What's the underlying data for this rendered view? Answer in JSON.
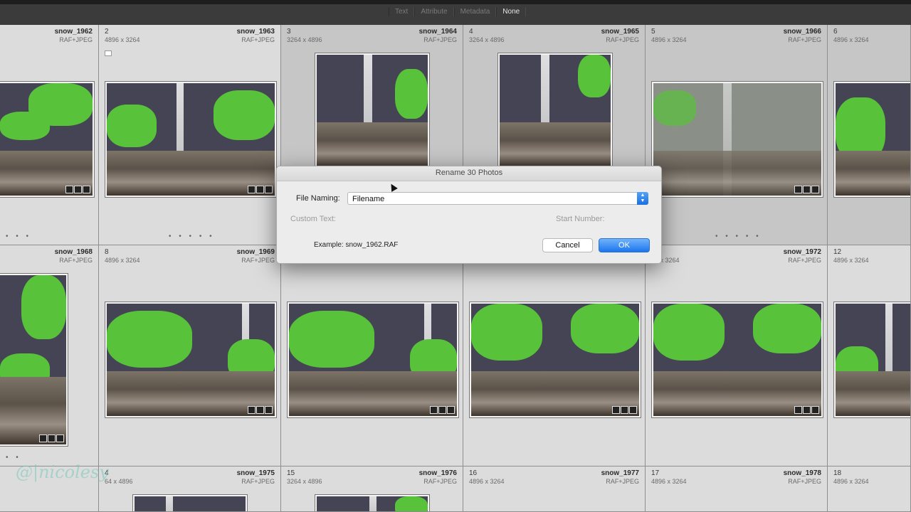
{
  "filter_bar": {
    "tabs": [
      "Text",
      "Attribute",
      "Metadata",
      "None"
    ],
    "active": "None"
  },
  "grid": {
    "row1": [
      {
        "index": "",
        "filename": "snow_1962",
        "type": "RAF+JPEG",
        "dims": ""
      },
      {
        "index": "2",
        "filename": "snow_1963",
        "type": "RAF+JPEG",
        "dims": "4896 x 3264"
      },
      {
        "index": "3",
        "filename": "snow_1964",
        "type": "RAF+JPEG",
        "dims": "3264 x 4896"
      },
      {
        "index": "4",
        "filename": "snow_1965",
        "type": "RAF+JPEG",
        "dims": "3264 x 4896"
      },
      {
        "index": "5",
        "filename": "snow_1966",
        "type": "RAF+JPEG",
        "dims": "4896 x 3264"
      },
      {
        "index": "6",
        "filename": "",
        "type": "",
        "dims": "4896 x 3264"
      }
    ],
    "row2": [
      {
        "index": "",
        "filename": "snow_1968",
        "type": "RAF+JPEG",
        "dims": ""
      },
      {
        "index": "8",
        "filename": "snow_1969",
        "type": "RAF+JPEG",
        "dims": "4896 x 3264"
      },
      {
        "index": "",
        "filename": "",
        "type": "",
        "dims": ""
      },
      {
        "index": "",
        "filename": "",
        "type": "",
        "dims": ""
      },
      {
        "index": "",
        "filename": "snow_1972",
        "type": "RAF+JPEG",
        "dims": "96 x 3264"
      },
      {
        "index": "12",
        "filename": "",
        "type": "",
        "dims": "4896 x 3264"
      }
    ],
    "row3": [
      {
        "index": "4",
        "filename": "",
        "type": "",
        "dims": "64 x 4896"
      },
      {
        "index": "",
        "filename": "snow_1975",
        "type": "RAF+JPEG",
        "dims": ""
      },
      {
        "index": "15",
        "filename": "snow_1976",
        "type": "RAF+JPEG",
        "dims": "3264 x 4896"
      },
      {
        "index": "16",
        "filename": "snow_1977",
        "type": "RAF+JPEG",
        "dims": "4896 x 3264"
      },
      {
        "index": "17",
        "filename": "snow_1978",
        "type": "RAF+JPEG",
        "dims": "4896 x 3264"
      },
      {
        "index": "18",
        "filename": "",
        "type": "",
        "dims": "4896 x 3264"
      }
    ]
  },
  "dialog": {
    "title": "Rename 30 Photos",
    "file_naming_label": "File Naming:",
    "file_naming_value": "Filename",
    "custom_text_label": "Custom Text:",
    "start_number_label": "Start Number:",
    "example_label": "Example:",
    "example_value": "snow_1962.RAF",
    "cancel_label": "Cancel",
    "ok_label": "OK"
  },
  "watermark": "@|nicolesy",
  "colors": {
    "accent": "#1d76ee",
    "grid_bg": "#c6c6c6"
  }
}
